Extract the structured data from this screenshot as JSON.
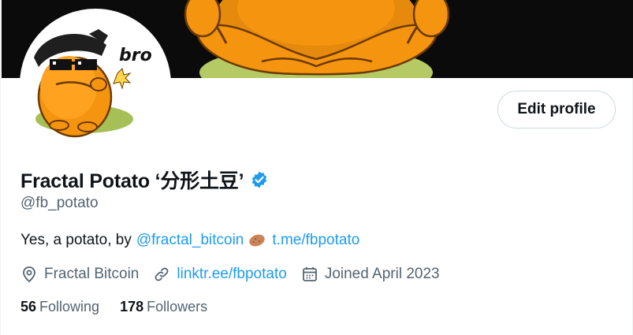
{
  "profile": {
    "display_name": "Fractal Potato ‘分形土豆’",
    "handle": "@fb_potato",
    "verified_icon": "verified-badge-icon",
    "avatar_caption": "bro"
  },
  "buttons": {
    "edit_profile": "Edit profile"
  },
  "bio": {
    "prefix": "Yes, a potato, by",
    "mention": "@fractal_bitcoin",
    "emoji": "potato-emoji",
    "link": "t.me/fbpotato"
  },
  "meta": {
    "location": "Fractal Bitcoin",
    "website": "linktr.ee/fbpotato",
    "joined": "Joined April 2023"
  },
  "stats": {
    "following_count": "56",
    "following_label": "Following",
    "followers_count": "178",
    "followers_label": "Followers"
  },
  "colors": {
    "accent_blue": "#1d9bf0",
    "secondary_text": "#536471",
    "primary_text": "#0f1419",
    "potato_orange": "#f5940e"
  }
}
